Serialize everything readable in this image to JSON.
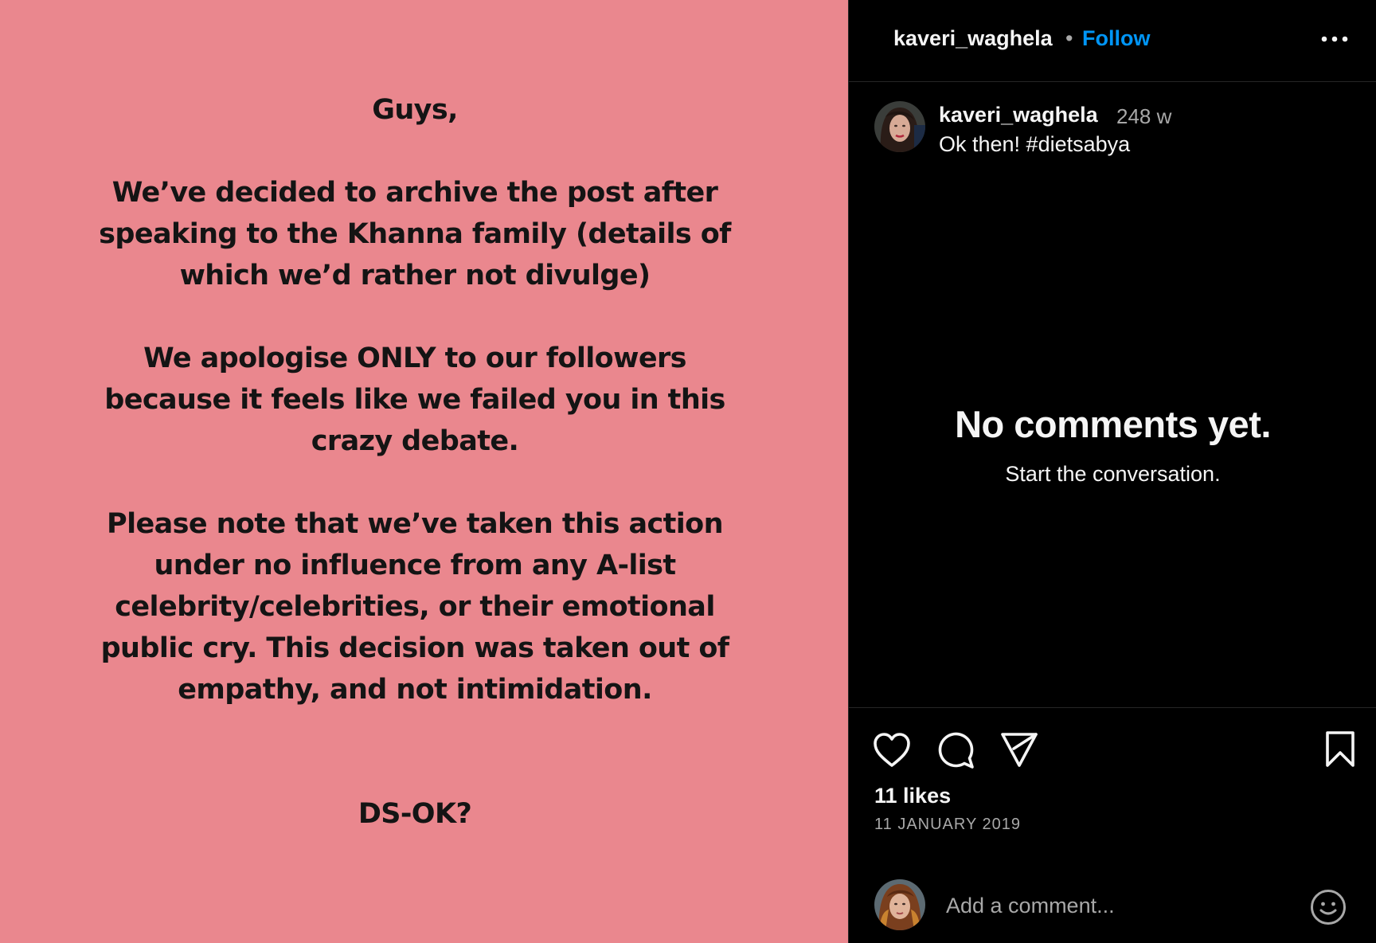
{
  "post": {
    "paragraphs": [
      "Guys,",
      "We’ve decided to archive the post after\nspeaking to the Khanna family (details of\nwhich we’d rather not divulge)",
      "We apologise ONLY to our followers\nbecause it feels like we failed you in this\ncrazy debate.",
      "Please note that we’ve taken this action\nunder no influence from any A-list\ncelebrity/celebrities, or their emotional\npublic cry.  This decision was taken out of\nempathy, and not intimidation.",
      "DS-OK?"
    ],
    "background_color": "#ea878e"
  },
  "header": {
    "username": "kaveri_waghela",
    "separator": "•",
    "follow_label": "Follow",
    "more_icon": "more-horizontal-icon"
  },
  "caption": {
    "username": "kaveri_waghela",
    "time": "248 w",
    "text": "Ok then! #dietsabya"
  },
  "comments": {
    "empty_title": "No comments yet.",
    "empty_subtitle": "Start the conversation."
  },
  "actions": {
    "like_icon": "heart-icon",
    "comment_icon": "comment-icon",
    "share_icon": "send-icon",
    "save_icon": "bookmark-icon",
    "likes": "11 likes",
    "date": "11 JANUARY 2019"
  },
  "add_comment": {
    "placeholder": "Add a comment...",
    "emoji_icon": "emoji-icon"
  },
  "colors": {
    "accent": "#0095f6",
    "background": "#000000",
    "divider": "#262626"
  }
}
